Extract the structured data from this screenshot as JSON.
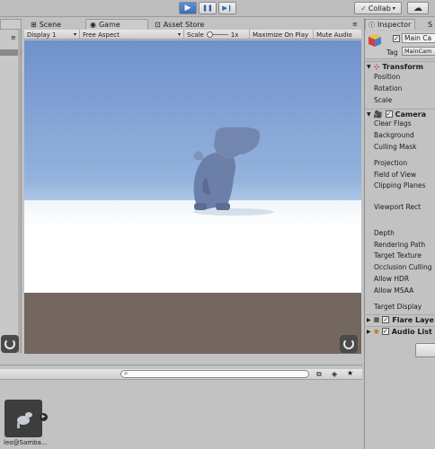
{
  "toolbar": {
    "collab_label": "Collab",
    "collab_arrow": "▾",
    "cloud_glyph": "☁",
    "play_glyph": "▶",
    "pause_glyph": "❚❚",
    "step_glyph": "▶❙"
  },
  "tabs": [
    {
      "label": "Scene"
    },
    {
      "label": "Game"
    },
    {
      "label": "Asset Store"
    }
  ],
  "game_bar": {
    "display": "Display 1",
    "aspect": "Free Aspect",
    "scale_label": "Scale",
    "scale_value": "1x",
    "maximize": "Maximize On Play",
    "mute": "Mute Audio"
  },
  "inspector": {
    "tab_label": "Inspector",
    "tab2_label": "S",
    "object_name": "Main Ca",
    "tag_label": "Tag",
    "tag_value": "MainCam",
    "transform": {
      "title": "Transform",
      "fields": [
        "Position",
        "Rotation",
        "Scale"
      ]
    },
    "camera": {
      "title": "Camera",
      "fields": [
        "Clear Flags",
        "Background",
        "Culling Mask",
        "Projection",
        "Field of View",
        "Clipping Planes",
        "Viewport Rect",
        "Depth",
        "Rendering Path",
        "Target Texture",
        "Occlusion Culling",
        "Allow HDR",
        "Allow MSAA",
        "Target Display"
      ]
    },
    "flare": {
      "title": "Flare Laye"
    },
    "audio": {
      "title": "Audio List"
    }
  },
  "project": {
    "search_placeholder": "",
    "asset_label": "leo@Samba..."
  },
  "colors": {
    "accent_play": "#4a7cc4",
    "sky_top": "#6f91cc",
    "ground": "#f4f8fb",
    "floor": "#74675f"
  }
}
